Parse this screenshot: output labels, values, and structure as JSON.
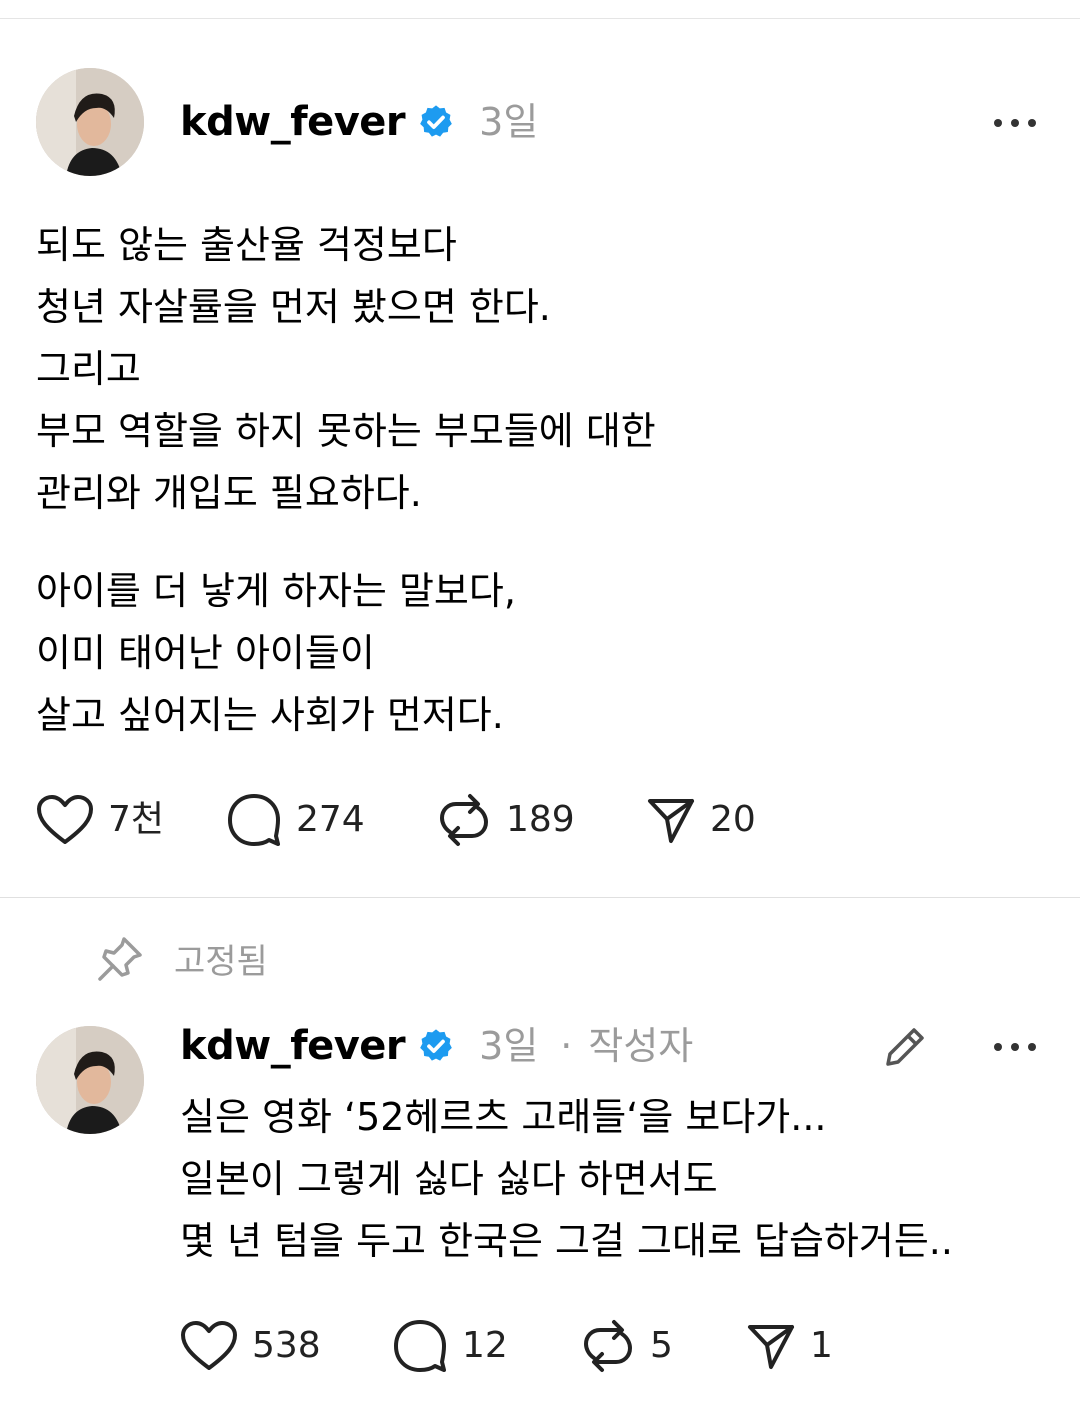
{
  "post": {
    "username": "kdw_fever",
    "time": "3일",
    "paragraph1": [
      "되도 않는 출산율 걱정보다",
      "청년 자살률을 먼저 봤으면 한다.",
      "그리고",
      "부모 역할을 하지 못하는 부모들에 대한",
      "관리와 개입도 필요하다."
    ],
    "paragraph2": [
      "아이를 더 낳게 하자는 말보다,",
      "이미 태어난 아이들이",
      "살고 싶어지는 사회가 먼저다."
    ],
    "actions": {
      "likes": "7천",
      "comments": "274",
      "reposts": "189",
      "shares": "20"
    }
  },
  "reply": {
    "pinned_label": "고정됨",
    "username": "kdw_fever",
    "time": "3일",
    "separator": "·",
    "author_tag": "작성자",
    "lines": [
      "실은 영화 ‘52헤르츠 고래들‘을 보다가...",
      "일본이 그렇게 싫다 싫다 하면서도",
      "몇 년 텀을 두고 한국은 그걸 그대로 답습하거든.."
    ],
    "actions": {
      "likes": "538",
      "comments": "12",
      "reposts": "5",
      "shares": "1"
    }
  },
  "icons": {
    "verified": "verified-badge-icon",
    "more": "more-horizontal-icon",
    "like": "heart-icon",
    "comment": "comment-bubble-icon",
    "repost": "repost-icon",
    "share": "send-icon",
    "pin": "pin-icon",
    "edit": "pencil-icon"
  },
  "colors": {
    "verified": "#1d9bf0",
    "muted": "#9b9b9b",
    "text": "#000000"
  }
}
